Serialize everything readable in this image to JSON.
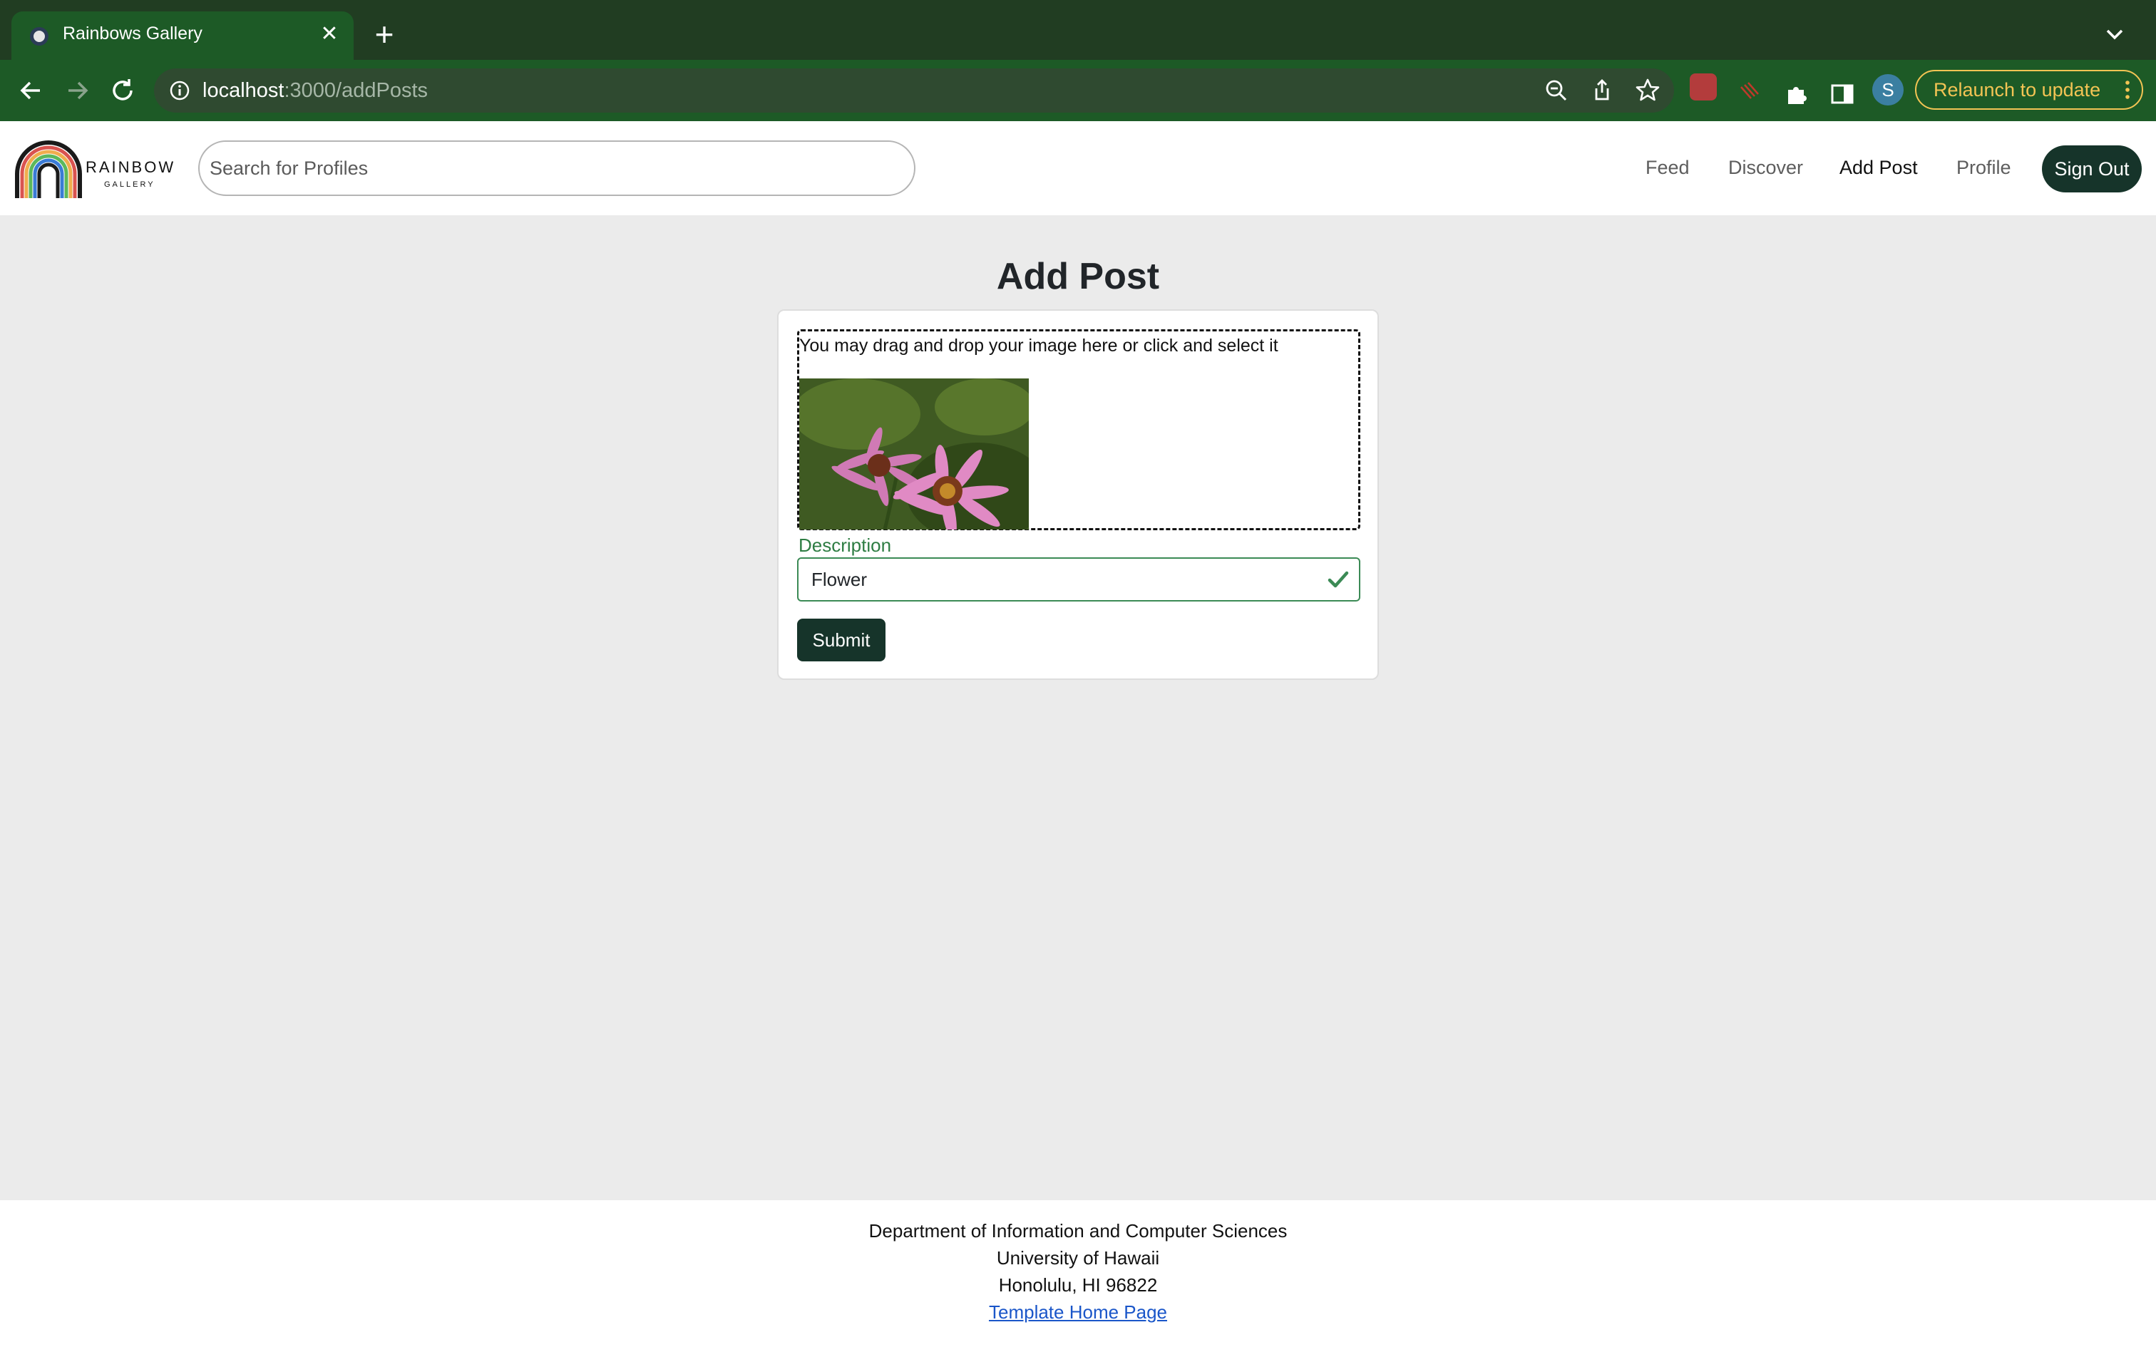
{
  "browser": {
    "tab_title": "Rainbows Gallery",
    "url_host": "localhost",
    "url_rest": ":3000/addPosts",
    "relaunch_label": "Relaunch to update",
    "profile_initial": "S"
  },
  "navbar": {
    "logo_text": "RAINBOW",
    "logo_subtext": "GALLERY",
    "search_placeholder": "Search for Profiles",
    "links": [
      "Feed",
      "Discover",
      "Add Post",
      "Profile"
    ],
    "active_link": "Add Post",
    "signout_label": "Sign Out"
  },
  "main": {
    "title": "Add Post",
    "dropzone_text": "You may drag and drop your image here or click and select it",
    "description_label": "Description",
    "description_value": "Flower",
    "submit_label": "Submit"
  },
  "footer": {
    "line1": "Department of Information and Computer Sciences",
    "line2": "University of Hawaii",
    "line3": "Honolulu, HI 96822",
    "link_text": "Template Home Page"
  },
  "colors": {
    "chrome_dark": "#213d22",
    "chrome_toolbar": "#1d5a26",
    "brand_dark": "#16342a",
    "valid_green": "#3b8a55",
    "relaunch_yellow": "#f3c454"
  }
}
